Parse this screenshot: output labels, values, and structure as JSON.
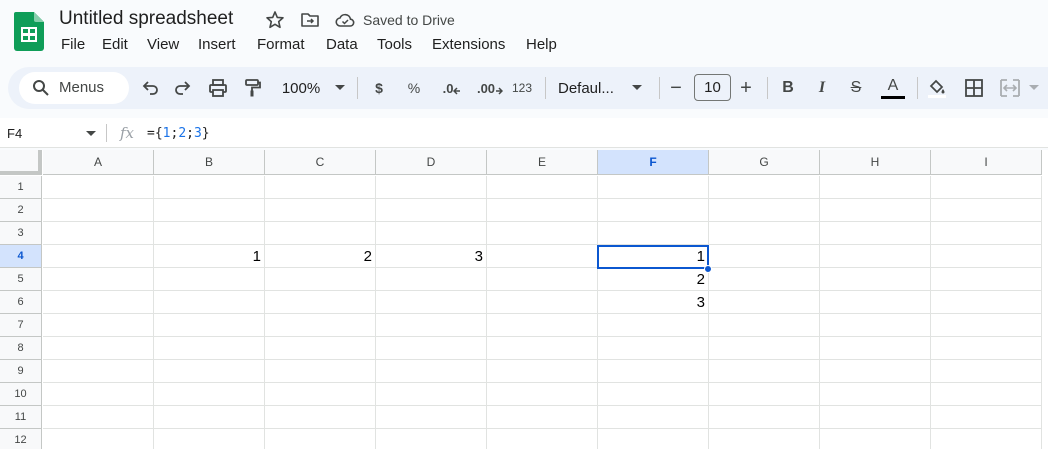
{
  "app": {
    "title": "Untitled spreadsheet",
    "saved_status": "Saved to Drive",
    "brand_color": "#0f9d58"
  },
  "menu": [
    "File",
    "Edit",
    "View",
    "Insert",
    "Format",
    "Data",
    "Tools",
    "Extensions",
    "Help"
  ],
  "toolbar": {
    "search_label": "Menus",
    "zoom": "100%",
    "currency": "$",
    "percent": "%",
    "decrease_decimal": ".0",
    "increase_decimal": ".00",
    "number_format": "123",
    "font": "Defaul...",
    "font_size": "10",
    "minus": "−",
    "plus": "+",
    "bold": "B",
    "italic": "I",
    "strike": "S",
    "text_color": "A"
  },
  "formula_bar": {
    "name_box": "F4",
    "fx": "fx",
    "formula_prefix": "={",
    "formula_n1": "1",
    "formula_sep1": ";",
    "formula_n2": "2",
    "formula_sep2": ";",
    "formula_n3": "3",
    "formula_suffix": "}"
  },
  "sheet": {
    "columns": [
      "A",
      "B",
      "C",
      "D",
      "E",
      "F",
      "G",
      "H",
      "I"
    ],
    "rows": [
      "1",
      "2",
      "3",
      "4",
      "5",
      "6",
      "7",
      "8",
      "9",
      "10",
      "11",
      "12"
    ],
    "selected_column": "F",
    "selected_row": "4",
    "cells": {
      "B4": "1",
      "C4": "2",
      "D4": "3",
      "F4": "1",
      "F5": "2",
      "F6": "3"
    }
  }
}
